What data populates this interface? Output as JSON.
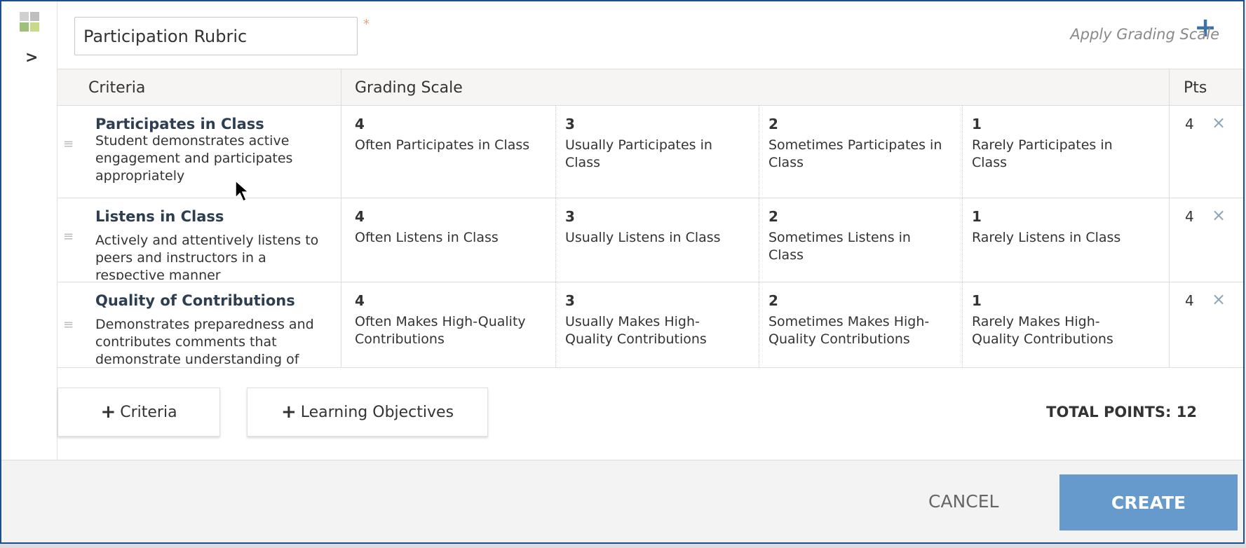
{
  "rubric": {
    "title_value": "Participation Rubric",
    "required_mark": "*",
    "apply_grading_scale": "Apply Grading Scale",
    "add_icon": "plus-icon"
  },
  "table": {
    "headers": {
      "criteria": "Criteria",
      "grading_scale": "Grading Scale",
      "pts": "Pts"
    },
    "rows": [
      {
        "name": "Participates in Class",
        "description": "Student demonstrates active engagement and participates appropriately",
        "levels": [
          {
            "score": "4",
            "desc": "Often Participates in Class"
          },
          {
            "score": "3",
            "desc": "Usually Participates in Class"
          },
          {
            "score": "2",
            "desc": "Sometimes Participates in Class"
          },
          {
            "score": "1",
            "desc": "Rarely Participates in Class"
          }
        ],
        "pts": "4",
        "remove": "×"
      },
      {
        "name": "Listens in Class",
        "description": "Actively and attentively listens to peers and instructors in a respective manner",
        "levels": [
          {
            "score": "4",
            "desc": "Often Listens in Class"
          },
          {
            "score": "3",
            "desc": "Usually Listens in Class"
          },
          {
            "score": "2",
            "desc": "Sometimes Listens in Class"
          },
          {
            "score": "1",
            "desc": "Rarely Listens in Class"
          }
        ],
        "pts": "4",
        "remove": "×"
      },
      {
        "name": "Quality of Contributions",
        "description": "Demonstrates preparedness and contributes comments that demonstrate understanding of",
        "levels": [
          {
            "score": "4",
            "desc": "Often Makes High-Quality Contributions"
          },
          {
            "score": "3",
            "desc": "Usually Makes High-Quality Contributions"
          },
          {
            "score": "2",
            "desc": "Sometimes Makes High-Quality Contributions"
          },
          {
            "score": "1",
            "desc": "Rarely Makes High-Quality Contributions"
          }
        ],
        "pts": "4",
        "remove": "×"
      }
    ]
  },
  "actions": {
    "add_criteria": "Criteria",
    "add_learning_objectives": "Learning Objectives",
    "plus_glyph": "+",
    "total_points": "TOTAL POINTS: 12"
  },
  "footer": {
    "cancel": "CANCEL",
    "create": "CREATE"
  },
  "colors": {
    "accent": "#6699cc",
    "border": "#1f4f8a",
    "header_bg": "#f6f5f3",
    "star": "#e8a37a"
  }
}
